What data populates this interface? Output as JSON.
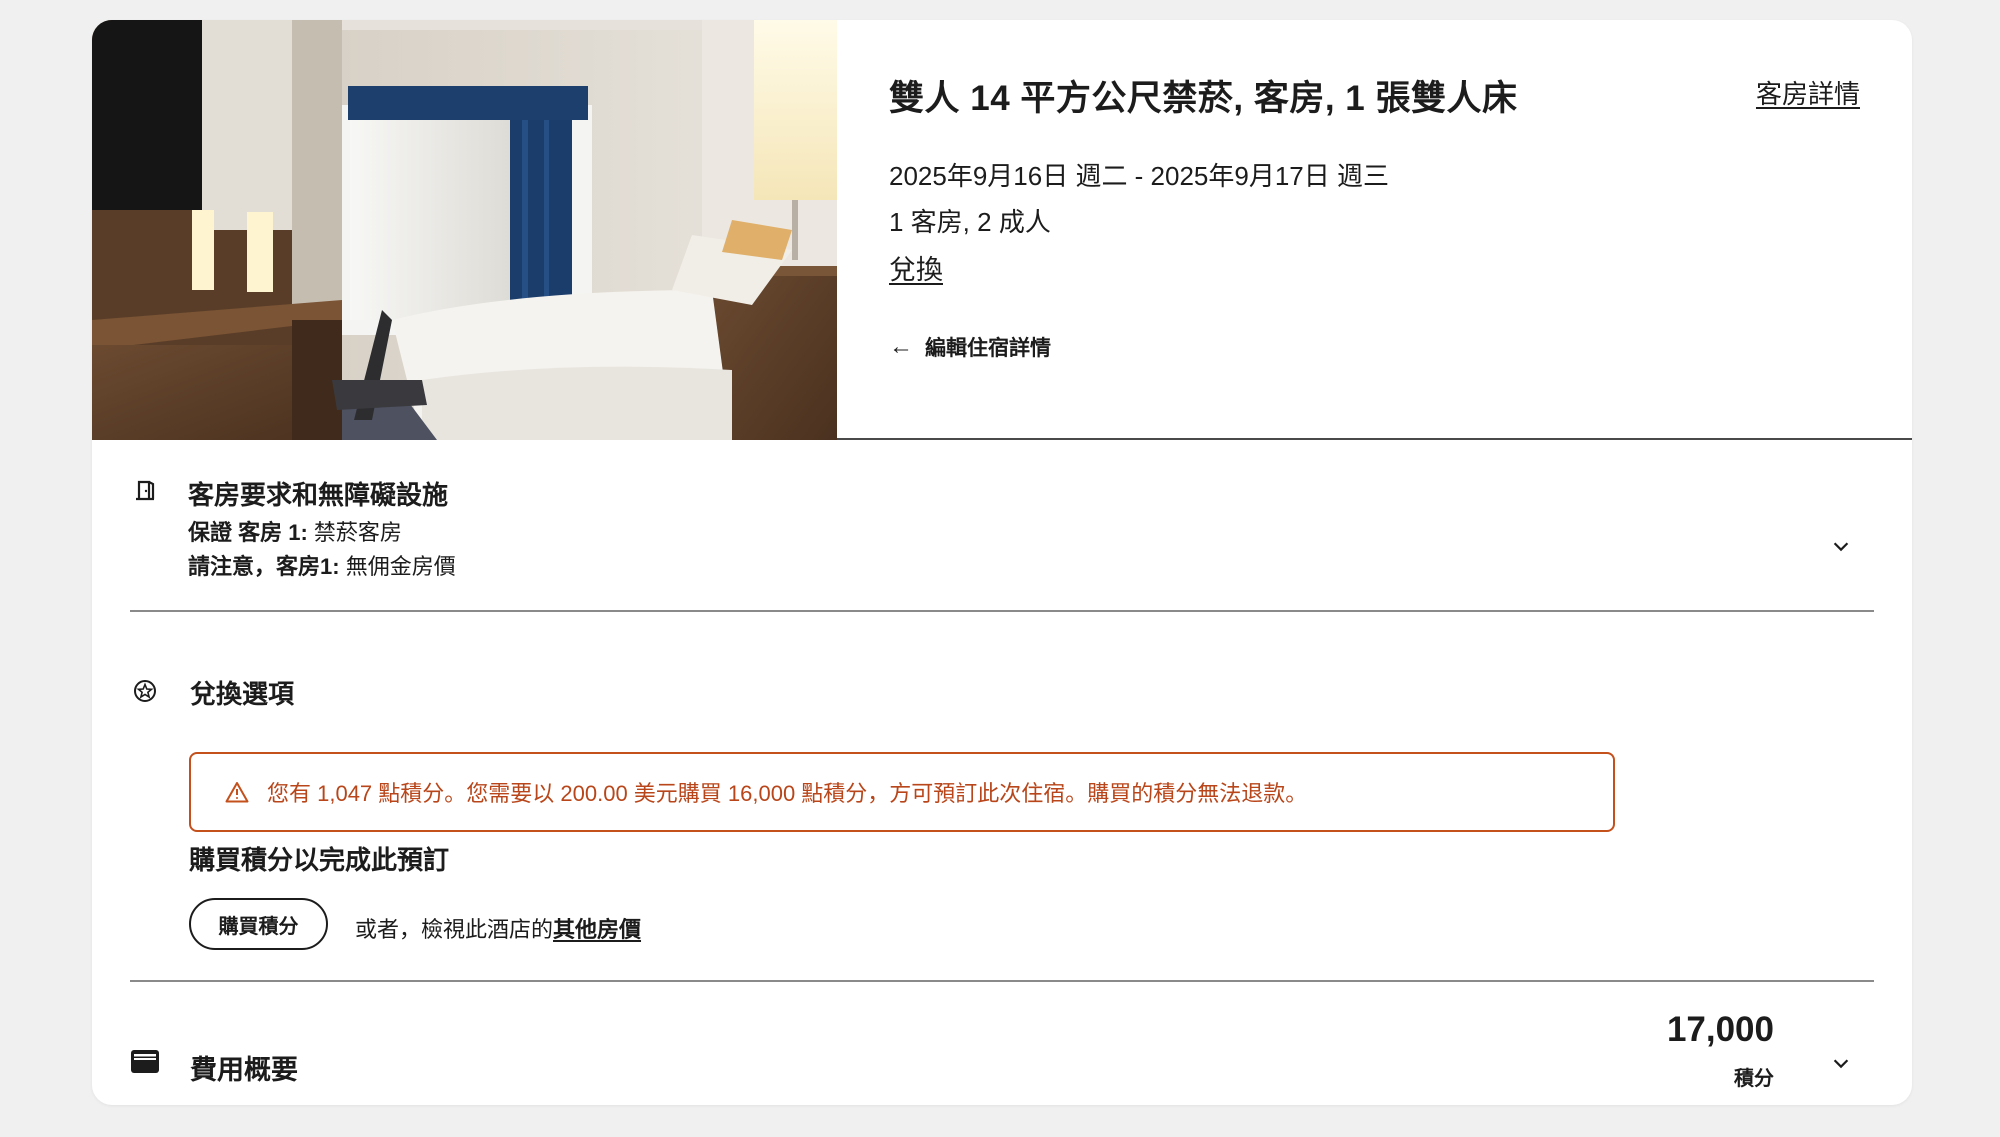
{
  "hero": {
    "room_title": "雙人 14 平方公尺禁菸, 客房, 1 張雙人床",
    "room_details_link": "客房詳情",
    "dates": "2025年9月16日 週二 - 2025年9月17日 週三",
    "guests": "1 客房, 2 成人",
    "redeem_link": "兌換",
    "edit_arrow": "←",
    "edit_label": "編輯住宿詳情"
  },
  "requests": {
    "icon": "door-icon",
    "title": "客房要求和無障礙設施",
    "line1_label": "保證 客房 1:",
    "line1_value": "禁菸客房",
    "line2_label": "請注意，客房1:",
    "line2_value": "無佣金房價"
  },
  "redemption": {
    "icon": "star-badge-icon",
    "title": "兌換選項",
    "alert_text": "您有 1,047 點積分。您需要以 200.00 美元購買 16,000 點積分，方可預訂此次住宿。購買的積分無法退款。",
    "buy_heading": "購買積分以完成此預訂",
    "buy_button": "購買積分",
    "or_prefix": "或者，檢視此酒店的",
    "other_rates_link": "其他房價"
  },
  "cost": {
    "icon": "wallet-icon",
    "title": "費用概要",
    "amount": "17,000",
    "unit": "積分"
  },
  "colors": {
    "alert": "#c4501c",
    "text": "#1c1c1c",
    "background": "#f0f0f0"
  }
}
